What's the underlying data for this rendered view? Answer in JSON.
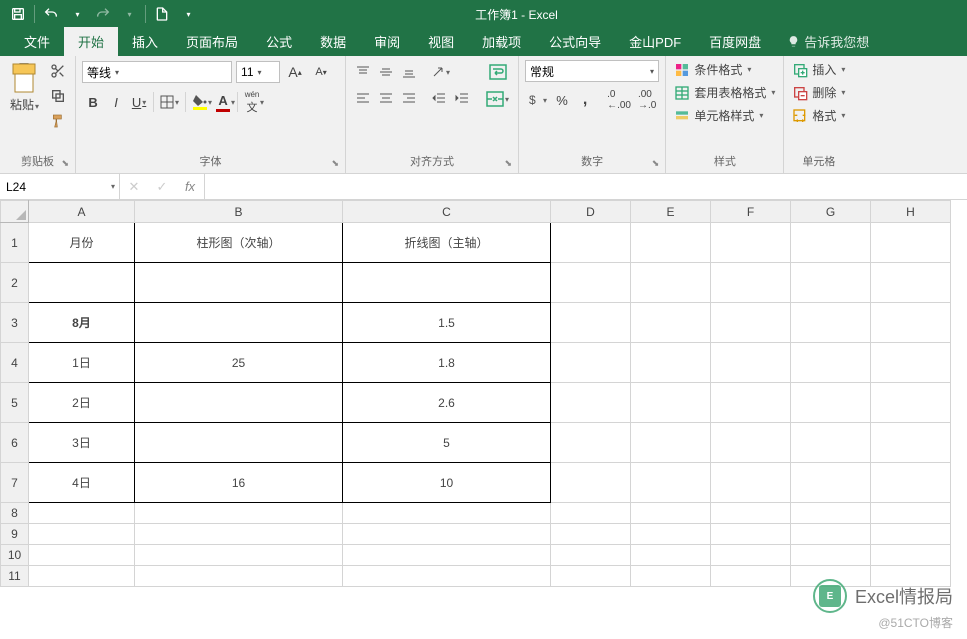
{
  "title": "工作簿1 - Excel",
  "tabs": [
    "文件",
    "开始",
    "插入",
    "页面布局",
    "公式",
    "数据",
    "审阅",
    "视图",
    "加载项",
    "公式向导",
    "金山PDF",
    "百度网盘"
  ],
  "active_tab": 1,
  "tell_me": "告诉我您想",
  "clipboard": {
    "paste": "粘贴",
    "label": "剪贴板"
  },
  "font": {
    "name": "等线",
    "size": "11",
    "bold": "B",
    "italic": "I",
    "underline": "U",
    "pinyin": "wén",
    "label": "字体"
  },
  "align": {
    "wrap": "",
    "merge": "",
    "label": "对齐方式"
  },
  "number": {
    "format": "常规",
    "label": "数字"
  },
  "styles": {
    "cond": "条件格式",
    "table": "套用表格格式",
    "cell": "单元格样式",
    "label": "样式"
  },
  "cells": {
    "insert": "插入",
    "delete": "删除",
    "format": "格式",
    "label": "单元格"
  },
  "name_box": "L24",
  "formula": "",
  "columns": [
    "A",
    "B",
    "C",
    "D",
    "E",
    "F",
    "G",
    "H"
  ],
  "rows": [
    "1",
    "2",
    "3",
    "4",
    "5",
    "6",
    "7",
    "8",
    "9",
    "10",
    "11"
  ],
  "sheet": {
    "headers": {
      "A": "月份",
      "B": "柱形图（次轴）",
      "C": "折线图（主轴）"
    },
    "data": [
      {
        "A": "8月",
        "B": "",
        "C": "1.5",
        "red": true
      },
      {
        "A": "1日",
        "B": "25",
        "C": "1.8"
      },
      {
        "A": "2日",
        "B": "",
        "C": "2.6"
      },
      {
        "A": "3日",
        "B": "",
        "C": "5"
      },
      {
        "A": "4日",
        "B": "16",
        "C": "10"
      }
    ]
  },
  "watermark": {
    "main": "Excel情报局",
    "sub": "@51CTO博客",
    "badge": "E"
  }
}
